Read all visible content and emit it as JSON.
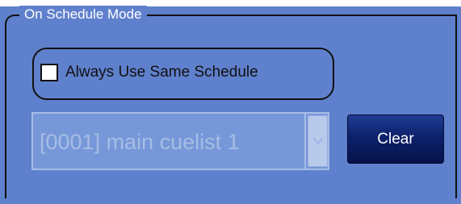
{
  "group": {
    "title": "On Schedule Mode"
  },
  "schedule_checkbox": {
    "label": "Always Use Same Schedule",
    "checked": false
  },
  "cuelist_select": {
    "selected_value": "[0001] main cuelist 1",
    "enabled": false
  },
  "clear_button": {
    "label": "Clear"
  },
  "colors": {
    "panel_background": "#5f80cc",
    "button_background": "#0d216b",
    "disabled_text": "#a7bde6"
  },
  "icons": {
    "dropdown_arrow": "chevron-down-icon"
  }
}
